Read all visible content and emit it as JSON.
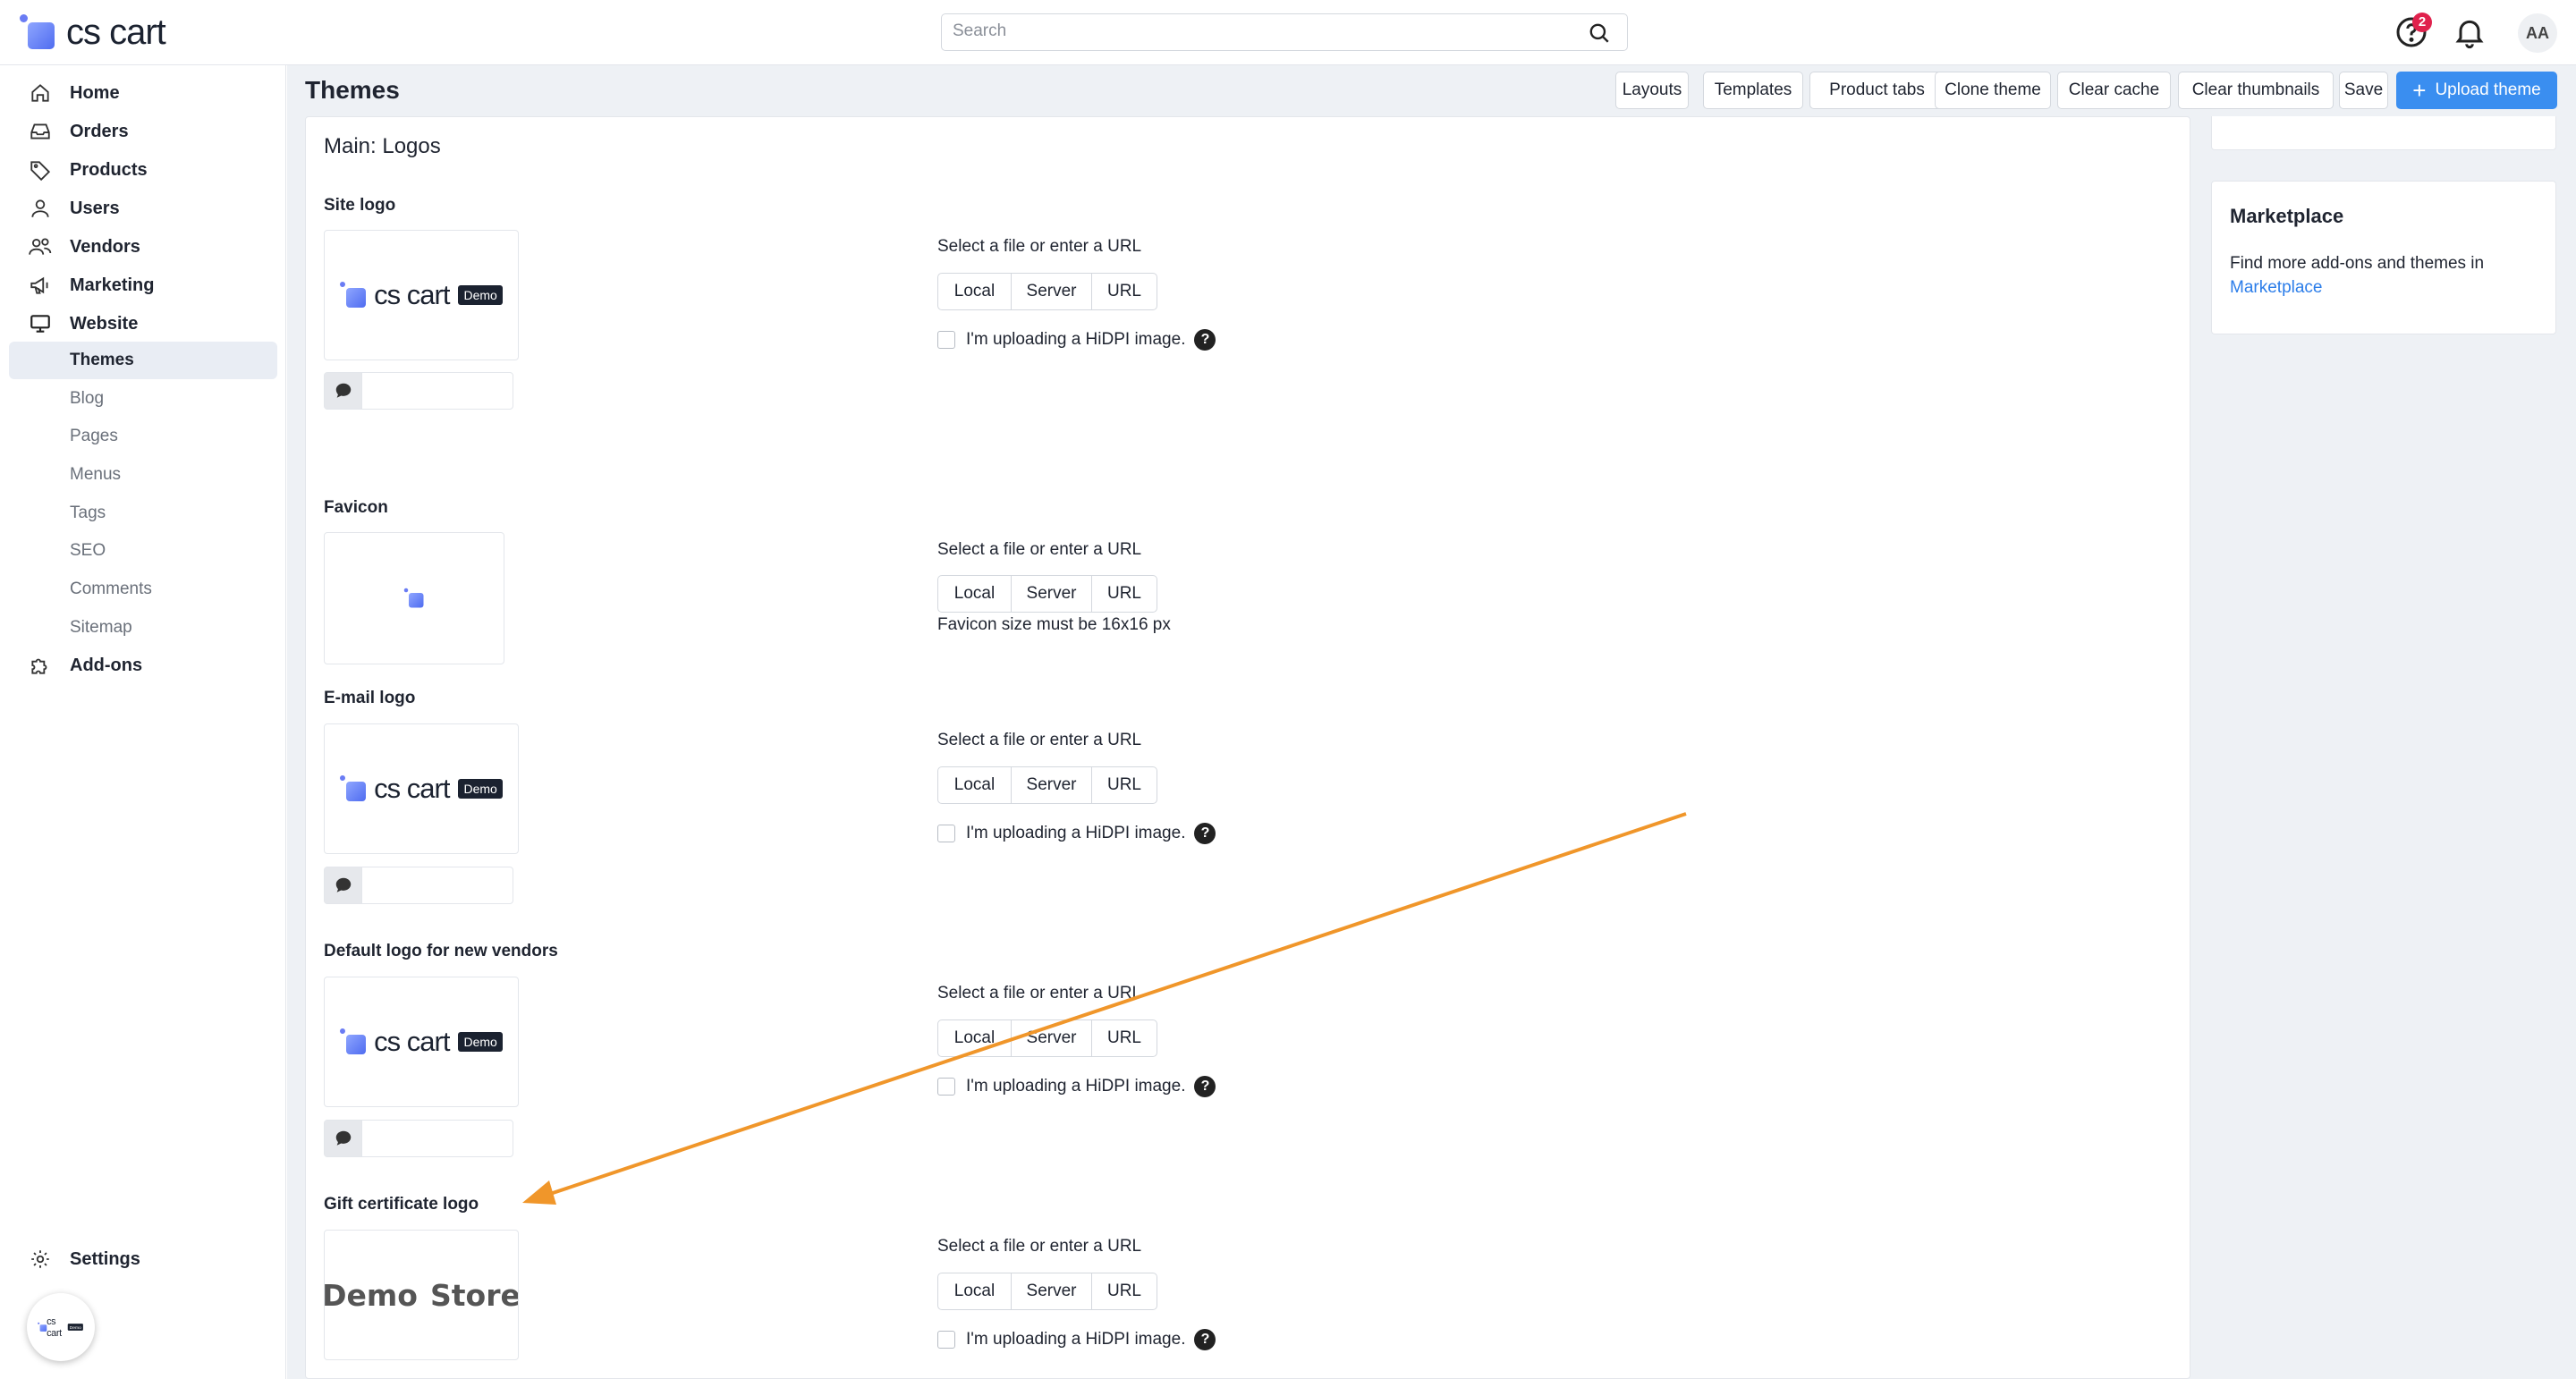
{
  "header": {
    "brand": "cs cart",
    "search_placeholder": "Search",
    "help_badge_count": "2",
    "avatar_initials": "AA"
  },
  "sidebar": {
    "items": [
      {
        "label": "Home",
        "icon": "home-icon"
      },
      {
        "label": "Orders",
        "icon": "inbox-icon"
      },
      {
        "label": "Products",
        "icon": "tag-icon"
      },
      {
        "label": "Users",
        "icon": "user-icon"
      },
      {
        "label": "Vendors",
        "icon": "users-icon"
      },
      {
        "label": "Marketing",
        "icon": "megaphone-icon"
      },
      {
        "label": "Website",
        "icon": "monitor-icon"
      }
    ],
    "website_sub": [
      "Themes",
      "Blog",
      "Pages",
      "Menus",
      "Tags",
      "SEO",
      "Comments",
      "Sitemap"
    ],
    "addons_label": "Add-ons",
    "settings_label": "Settings"
  },
  "page": {
    "title": "Themes",
    "toolbar": [
      "Layouts",
      "Templates",
      "Product tabs",
      "Clone theme",
      "Clear cache",
      "Clear thumbnails",
      "Save"
    ],
    "upload_label": "Upload theme"
  },
  "content": {
    "section_title": "Main: Logos",
    "select_label": "Select a file or enter a URL",
    "seg": [
      "Local",
      "Server",
      "URL"
    ],
    "hidpi_label": "I'm uploading a HiDPI image.",
    "help_symbol": "?",
    "favicon_note": "Favicon size must be 16x16 px",
    "logo_demo_tag": "Demo",
    "logo_text": "cs cart",
    "gift_logo_words": [
      "Demo",
      "Store"
    ],
    "fields": [
      "Site logo",
      "Favicon",
      "E-mail logo",
      "Default logo for new vendors",
      "Gift certificate logo"
    ]
  },
  "right_panel": {
    "title": "Marketplace",
    "text": "Find more add-ons and themes in",
    "link": "Marketplace"
  },
  "colors": {
    "primary": "#3a8ef0",
    "annotation_arrow": "#f0962a",
    "badge": "#e0224d"
  }
}
